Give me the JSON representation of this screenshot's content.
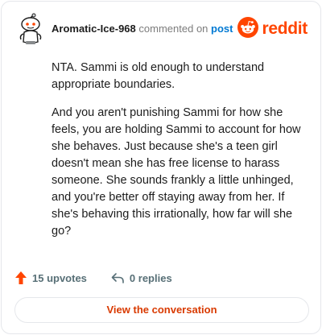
{
  "header": {
    "author": "Aromatic-Ice-968",
    "action": "commented on",
    "post_link": "post",
    "brand": "reddit"
  },
  "comment": {
    "paragraphs": [
      "NTA. Sammi is old enough to understand appropriate boundaries.",
      "And you aren't punishing Sammi for how she feels, you are holding Sammi to account for how she behaves. Just because she's a teen girl doesn't mean she has free license to harass someone. She sounds frankly a little unhinged, and you're better off staying away from her. If she's behaving this irrationally, how far will she go?"
    ]
  },
  "footer": {
    "upvotes": "15 upvotes",
    "replies": "0 replies"
  },
  "cta": {
    "label": "View the conversation"
  },
  "colors": {
    "accent": "#ff4500",
    "link": "#0079d3",
    "cta_text": "#d93a00"
  },
  "icons": {
    "avatar": "snoo-avatar-icon",
    "brand": "reddit-logo-icon",
    "upvote": "upvote-arrow-icon",
    "reply": "reply-arrow-icon"
  }
}
